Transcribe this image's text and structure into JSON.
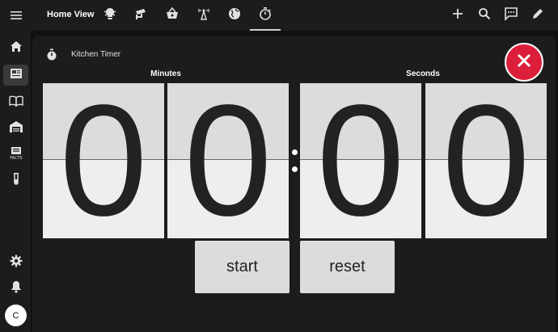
{
  "app": {
    "title": "Home View"
  },
  "sidebar": {
    "avatar_initial": "C"
  },
  "card": {
    "title": "Kitchen Timer",
    "minutes_label": "Minutes",
    "seconds_label": "Seconds",
    "digits": [
      "0",
      "0",
      "0",
      "0"
    ],
    "start_label": "start",
    "reset_label": "reset"
  },
  "colors": {
    "accent_red": "#db1f3b",
    "topbar": "#1c1c1c",
    "background": "#111111"
  },
  "icons": {
    "tabs": [
      "bulb-icon",
      "cctv-icon",
      "basket-icon",
      "antenna-icon",
      "globe-icon",
      "timer-icon"
    ],
    "actions": [
      "plus-icon",
      "search-icon",
      "chat-icon",
      "pencil-icon"
    ],
    "sidebar": [
      "home-icon",
      "dashboard-icon",
      "book-icon",
      "warehouse-icon",
      "facts-icon",
      "test-tube-icon",
      "gear-icon",
      "bell-icon"
    ]
  }
}
